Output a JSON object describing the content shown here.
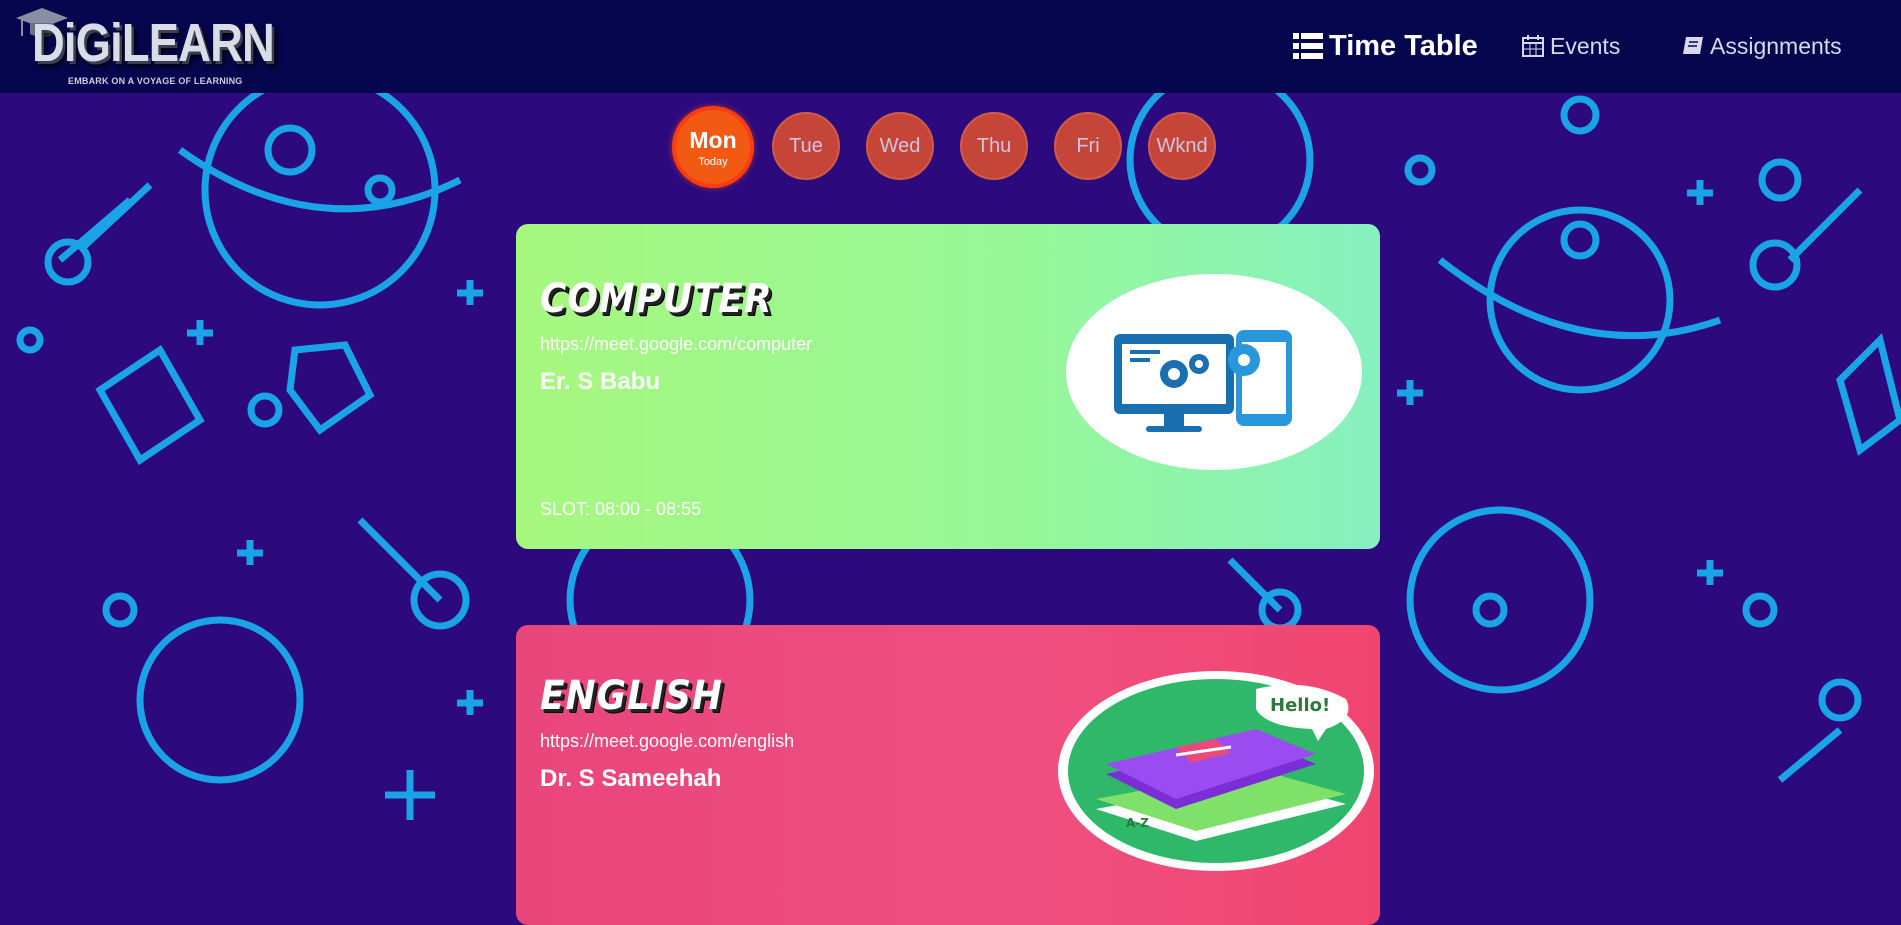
{
  "brand": {
    "name": "DiGiLEARN",
    "tagline": "EMBARK ON A VOYAGE OF LEARNING"
  },
  "nav": {
    "items": [
      {
        "label": "Time Table",
        "icon": "timetable-icon",
        "active": true
      },
      {
        "label": "Events",
        "icon": "calendar-icon",
        "active": false
      },
      {
        "label": "Assignments",
        "icon": "book-icon",
        "active": false
      }
    ]
  },
  "days": [
    {
      "label": "Mon",
      "sub": "Today",
      "selected": true
    },
    {
      "label": "Tue"
    },
    {
      "label": "Wed"
    },
    {
      "label": "Thu"
    },
    {
      "label": "Fri"
    },
    {
      "label": "Wknd"
    }
  ],
  "classes": [
    {
      "subject": "Computer",
      "link": "https://meet.google.com/computer",
      "teacher": "Er. S Babu",
      "slot": "SLOT: 08:00 - 08:55",
      "illustration": "computer-devices-illustration"
    },
    {
      "subject": "English",
      "link": "https://meet.google.com/english",
      "teacher": "Dr. S Sameehah",
      "illustration": "english-books-illustration",
      "illustration_text": "Hello!"
    }
  ],
  "colors": {
    "navbar": "#06064f",
    "background": "#2c0a7e",
    "pattern": "#1aa3e6",
    "day_button": "#e0502e",
    "today_button": "#f25a13",
    "computer_card": "#9ef78f",
    "english_card": "#ec4a7b"
  }
}
